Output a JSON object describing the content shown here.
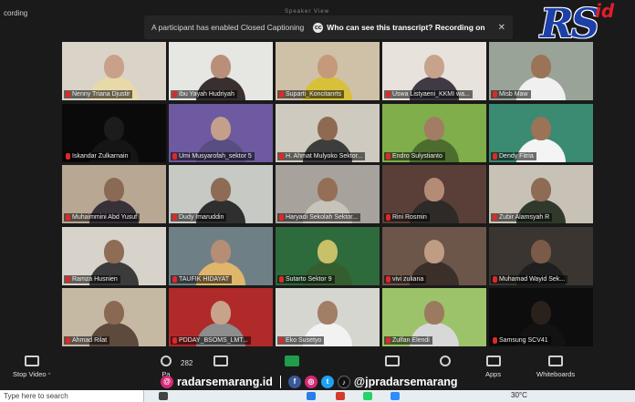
{
  "window": {
    "recording_label": "cording",
    "top_small_text": "Speaker View"
  },
  "banner": {
    "message": "A participant has enabled Closed Captioning",
    "question": "Who can see this transcript? Recording on",
    "cc_icon": "cc-icon",
    "close_icon": "close-icon"
  },
  "logo": {
    "main": "RS",
    "suffix": "id"
  },
  "participants": [
    {
      "name": "Nenny Triana Djustir",
      "bg": "#d9d3c8",
      "face": "#c9a089",
      "body": "#e8d9a8"
    },
    {
      "name": "Ibu Yayah Hudriyah",
      "bg": "#e6e6e2",
      "face": "#b98f7a",
      "body": "#3a2f2f"
    },
    {
      "name": "Suparti_Koncitanrts",
      "bg": "#cfc1a7",
      "face": "#c49a7a",
      "body": "#d8c03a"
    },
    {
      "name": "Uswa Listyaeni_KKMI wa...",
      "bg": "#e7e2db",
      "face": "#c6a38a",
      "body": "#3f3a44"
    },
    {
      "name": "Misb Maw",
      "bg": "#9aa398",
      "face": "#9b7356",
      "body": "#f0f0f0"
    },
    {
      "name": "Iskandar Zulkarnain",
      "bg": "#0a0a0a",
      "face": "#1c1c1c",
      "body": "#151515"
    },
    {
      "name": "Umi Musyarofah_sektor 5",
      "bg": "#6d5aa0",
      "face": "#c49f8a",
      "body": "#5a4d82"
    },
    {
      "name": "H. Ahmat Mulyoko Sektor...",
      "bg": "#cfcabf",
      "face": "#8f6a52",
      "body": "#3d3d3d"
    },
    {
      "name": "Endro Sulystianto",
      "bg": "#7fae4b",
      "face": "#a27d64",
      "body": "#4d6d2f"
    },
    {
      "name": "Dendy Fitria",
      "bg": "#3b8a72",
      "face": "#9b7356",
      "body": "#f4f4f4"
    },
    {
      "name": "Muhaimmini Abd Yusuf",
      "bg": "#b8a792",
      "face": "#8a6a55",
      "body": "#38313a"
    },
    {
      "name": "Dudy Imaruddin",
      "bg": "#c6c9c4",
      "face": "#8d6b54",
      "body": "#2f2f2f"
    },
    {
      "name": "Haryadi Sekolah Sektor...",
      "bg": "#a7a29b",
      "face": "#946f57",
      "body": "#c7c2ba"
    },
    {
      "name": "Rini Rosmin",
      "bg": "#5a3f38",
      "face": "#b48c75",
      "body": "#2e2a28"
    },
    {
      "name": "Zubir Alamsyah R",
      "bg": "#c8c2b6",
      "face": "#8e6b55",
      "body": "#2f3a2c"
    },
    {
      "name": "Ramza Husnien",
      "bg": "#d7d2ca",
      "face": "#8f6c56",
      "body": "#3b3b3b"
    },
    {
      "name": "TAUFIK HIDAYAT",
      "bg": "#6f7f86",
      "face": "#b58e75",
      "body": "#e0b56c"
    },
    {
      "name": "Sutarto Sektor 9",
      "bg": "#2e6b3c",
      "face": "#c9c06a",
      "body": "#355e2f"
    },
    {
      "name": "vivi zuliana",
      "bg": "#6c5649",
      "face": "#c09c84",
      "body": "#3b2f2a"
    },
    {
      "name": "Muhamad Wayid Sek...",
      "bg": "#3a3530",
      "face": "#7a5b48",
      "body": "#1f1f1f"
    },
    {
      "name": "Ahmad Rilat",
      "bg": "#c6b9a4",
      "face": "#8a6851",
      "body": "#5d4a3d"
    },
    {
      "name": "PDDAY_BSOMS_LMT...",
      "bg": "#b02a2a",
      "face": "#c7a38c",
      "body": "#8d8d8d"
    },
    {
      "name": "Eko Susetyo",
      "bg": "#d6d6d1",
      "face": "#a17e66",
      "body": "#f2f2f2"
    },
    {
      "name": "Zulfan Elendi",
      "bg": "#9cc36a",
      "face": "#9c7a60",
      "body": "#d8d8d8"
    },
    {
      "name": "Samsung SCV41",
      "bg": "#0d0d0d",
      "face": "#2a211c",
      "body": "#121212"
    }
  ],
  "toolbar": {
    "stop_video": "Stop Video",
    "participants_label": "Pa",
    "participants_count": "282",
    "apps": "Apps",
    "whiteboards": "Whiteboards"
  },
  "social": {
    "site": "radarsemarang.id",
    "handle": "@jpradarsemarang"
  },
  "taskbar": {
    "search_placeholder": "Type here to search",
    "temperature": "30°C"
  }
}
